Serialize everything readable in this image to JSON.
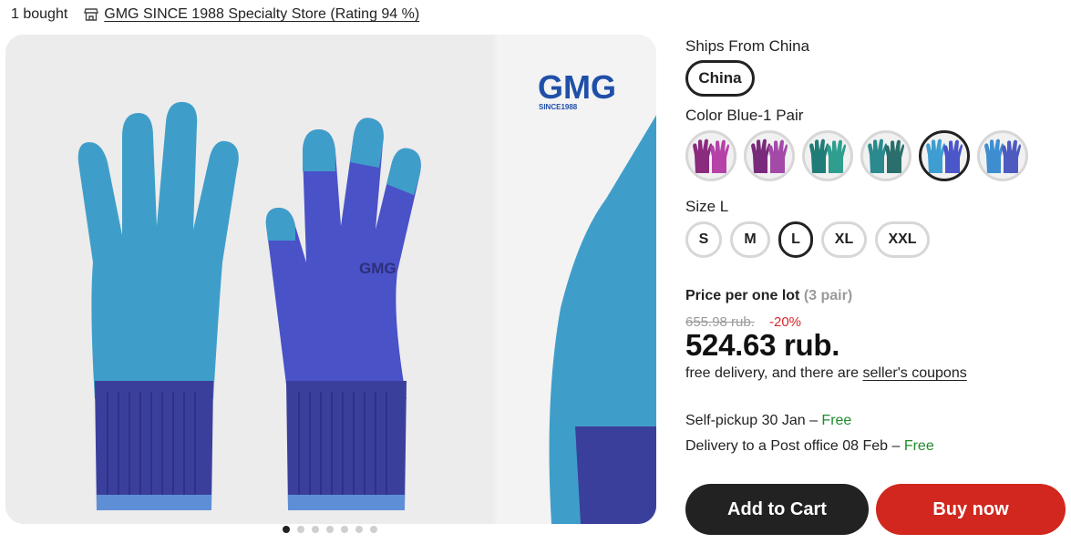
{
  "header": {
    "bought": "1 bought",
    "store_icon": "store-icon",
    "store_name": "GMG SINCE 1988 Specialty Store (Rating 94 %)"
  },
  "gallery": {
    "image_count": 7,
    "active_index": 0,
    "brand_text": "GMG",
    "brand_sub": "SINCE1988",
    "glove_print": "GMG",
    "colors": {
      "palm": "#3f9ec9",
      "body": "#4a52c8",
      "cuff": "#3b3f9c"
    }
  },
  "ships_from": {
    "label": "Ships From China",
    "option": "China"
  },
  "color": {
    "label": "Color Blue-1 Pair",
    "swatches": [
      {
        "name": "purple-1",
        "palm": "#8a2b7e",
        "body": "#b642a8"
      },
      {
        "name": "purple-2",
        "palm": "#7a2a7a",
        "body": "#a34aa8"
      },
      {
        "name": "teal-1",
        "palm": "#1f7c76",
        "body": "#2f9e8f"
      },
      {
        "name": "teal-2",
        "palm": "#2a8a8e",
        "body": "#2a6f6c"
      },
      {
        "name": "blue-1",
        "palm": "#3e9ed1",
        "body": "#4b56c9"
      },
      {
        "name": "blue-2",
        "palm": "#3e8ecf",
        "body": "#4d5bc0"
      }
    ],
    "selected_index": 4
  },
  "size": {
    "label": "Size L",
    "options": [
      "S",
      "M",
      "L",
      "XL",
      "XXL"
    ],
    "selected_index": 2
  },
  "price": {
    "title": "Price per one lot",
    "lot": "(3 pair)",
    "old": "655.98 rub.",
    "discount": "-20%",
    "current": "524.63 rub.",
    "note_prefix": "free delivery, and there are ",
    "coupons": "seller's coupons"
  },
  "shipping": {
    "pickup": "Self-pickup 30 Jan – ",
    "pickup_free": "Free",
    "post": "Delivery to a Post office 08 Feb – ",
    "post_free": "Free"
  },
  "actions": {
    "add_to_cart": "Add to Cart",
    "buy_now": "Buy now"
  }
}
